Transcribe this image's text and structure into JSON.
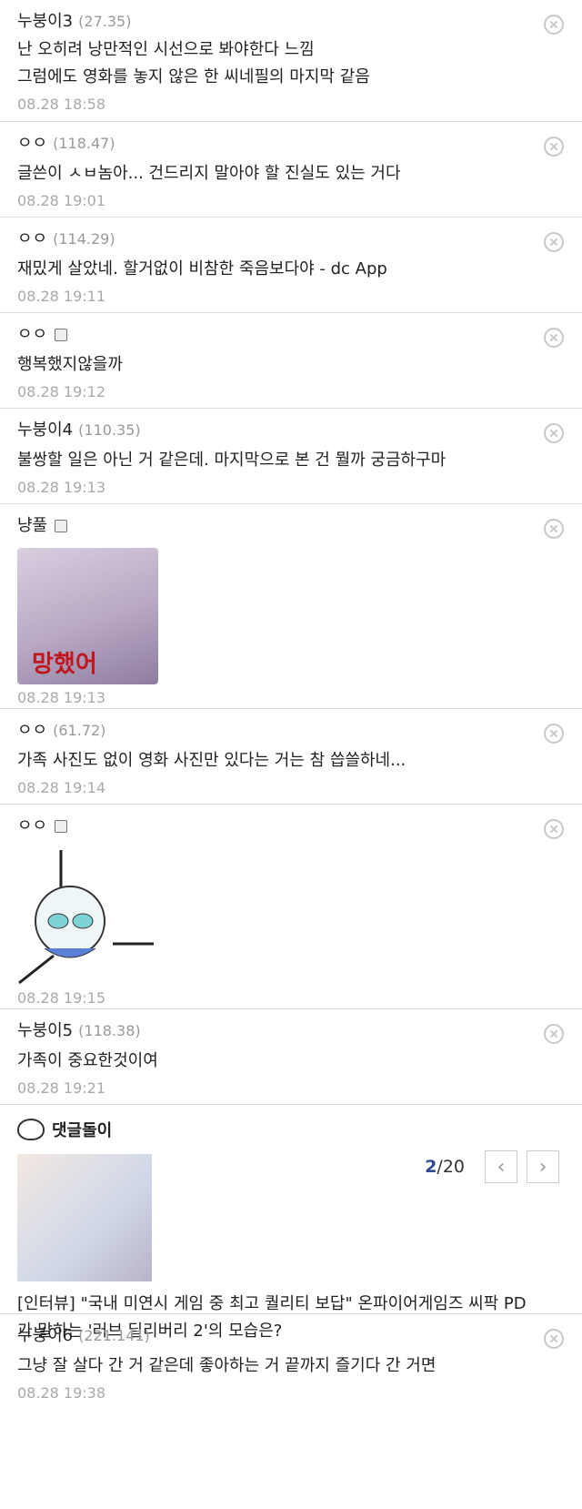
{
  "comments": [
    {
      "nick": "누붕이3",
      "ip": "(27.35)",
      "lines": [
        "난 오히려 낭만적인 시선으로 봐야한다 느낌",
        "그럼에도 영화를 놓지 않은 한 씨네필의 마지막 같음"
      ],
      "date": "08.28 18:58"
    },
    {
      "nick": "ㅇㅇ",
      "ip": "(118.47)",
      "lines": [
        "글쓴이 ㅅㅂ놈아... 건드리지 말아야 할 진실도 있는 거다"
      ],
      "date": "08.28 19:01"
    },
    {
      "nick": "ㅇㅇ",
      "ip": "(114.29)",
      "lines": [
        "재밌게 살았네. 할거없이 비참한 죽음보다야 - dc App"
      ],
      "date": "08.28 19:11"
    },
    {
      "nick": "ㅇㅇ",
      "ip": "",
      "lines": [
        "행복했지않을까"
      ],
      "date": "08.28 19:12"
    },
    {
      "nick": "누붕이4",
      "ip": "(110.35)",
      "lines": [
        "불쌍할 일은 아닌 거 같은데. 마지막으로 본 건 뭘까 궁금하구마"
      ],
      "date": "08.28 19:13"
    },
    {
      "nick": "냥풀",
      "ip": "",
      "image_caption": "망했어",
      "date": "08.28 19:13"
    },
    {
      "nick": "ㅇㅇ",
      "ip": "(61.72)",
      "lines": [
        "가족 사진도 없이 영화 사진만 있다는 거는 참 씁쓸하네..."
      ],
      "date": "08.28 19:14"
    },
    {
      "nick": "ㅇㅇ",
      "ip": "",
      "sticker": true,
      "date": "08.28 19:15"
    },
    {
      "nick": "누붕이5",
      "ip": "(118.38)",
      "lines": [
        "가족이 중요한것이여"
      ],
      "date": "08.28 19:21"
    },
    {
      "nick": "누붕이6",
      "ip": "(221.141)",
      "lines": [
        "그냥 잘 살다 간 거 같은데 좋아하는 거 끝까지 즐기다 간 거면"
      ],
      "date": "08.28 19:38"
    }
  ],
  "ad": {
    "label": "댓글돌이",
    "page_current": "2",
    "page_total": "/20",
    "title_lines": [
      "[인터뷰] \"국내 미연시 게임 중 최고 퀄리티 보답\" 온파이어게임즈 씨팍 PD",
      "가 말하는 '러브 딜리버리 2'의 모습은?"
    ]
  }
}
